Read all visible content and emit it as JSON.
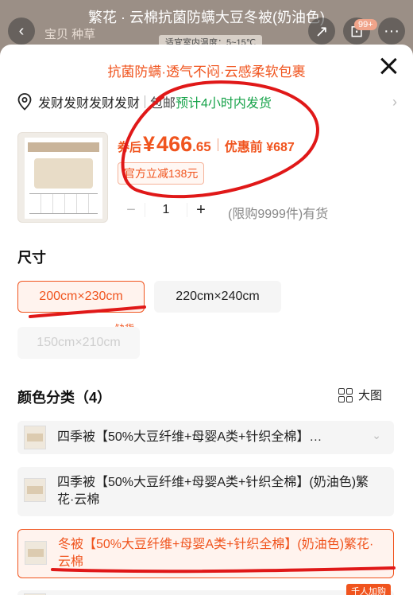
{
  "background": {
    "title": "繁花 · 云棉抗菌防螨大豆冬被(奶油色)",
    "tabs": "宝贝  种草",
    "hint": "适宜室内温度：5~15℃",
    "cart_badge": "99+"
  },
  "sheet": {
    "promo": "抗菌防螨·透气不闷·云感柔软包裹",
    "address": "发财发财发财发财",
    "shipping": "包邮",
    "eta": "预计4小时内发货",
    "price": {
      "label": "券后",
      "currency": "¥",
      "integer": "466",
      "decimal": ".65",
      "original": "优惠前 ¥687"
    },
    "coupon": "官方立减138元",
    "quantity": "1",
    "minus": "−",
    "plus": "+",
    "stock": "(限购9999件)有货",
    "size_title": "尺寸",
    "sizes": [
      {
        "label": "200cm×230cm",
        "state": "selected"
      },
      {
        "label": "220cm×240cm",
        "state": "normal"
      },
      {
        "label": "150cm×210cm",
        "state": "disabled"
      }
    ],
    "out_of_stock": "缺货",
    "color_title": "颜色分类（4）",
    "big_image": "大图",
    "options": [
      {
        "label": "四季被【50%大豆纤维+母婴A类+针织全棉】…",
        "state": "collapsed"
      },
      {
        "label": "四季被【50%大豆纤维+母婴A类+针织全棉】(奶油色)繁花·云棉",
        "state": "normal"
      },
      {
        "label": "冬被【50%大豆纤维+母婴A类+针织全棉】(奶油色)繁花·云棉",
        "state": "selected"
      }
    ],
    "hot_tag": "千人加购"
  },
  "colors": {
    "accent": "#f0541e",
    "eta": "#17a34a",
    "annotation": "#e01818"
  }
}
